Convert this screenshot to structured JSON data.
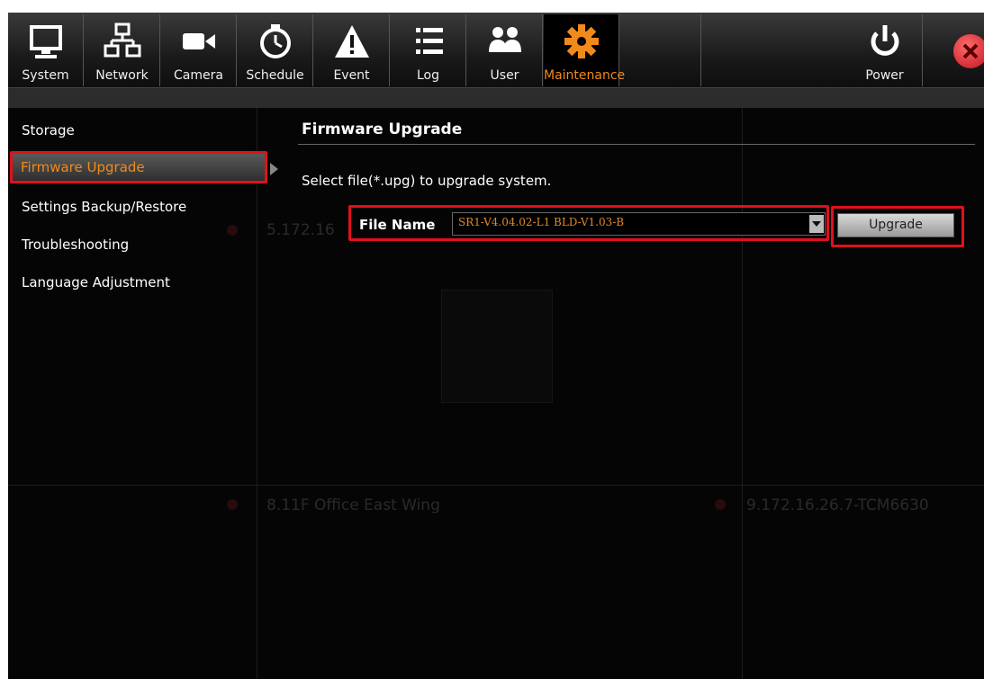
{
  "toolbar": {
    "items": [
      {
        "label": "System",
        "icon": "monitor-icon"
      },
      {
        "label": "Network",
        "icon": "network-icon"
      },
      {
        "label": "Camera",
        "icon": "camera-icon"
      },
      {
        "label": "Schedule",
        "icon": "clock-icon"
      },
      {
        "label": "Event",
        "icon": "warning-icon"
      },
      {
        "label": "Log",
        "icon": "list-icon"
      },
      {
        "label": "User",
        "icon": "users-icon"
      },
      {
        "label": "Maintenance",
        "icon": "gear-icon",
        "active": true
      },
      {
        "label": "Power",
        "icon": "power-icon"
      }
    ],
    "close_icon": "close-icon"
  },
  "sidebar": {
    "items": [
      {
        "label": "Storage"
      },
      {
        "label": "Firmware Upgrade",
        "selected": true
      },
      {
        "label": "Settings Backup/Restore"
      },
      {
        "label": "Troubleshooting"
      },
      {
        "label": "Language Adjustment"
      }
    ]
  },
  "main": {
    "title": "Firmware Upgrade",
    "instruction": "Select file(*.upg) to upgrade system.",
    "file_label": "File Name",
    "file_value": "SR1-V4.04.02-L1 BLD-V1.03-B",
    "upgrade_label": "Upgrade"
  },
  "background": {
    "ghost_1": "5.172.16",
    "ghost_2": "8.11F Office East Wing",
    "ghost_3": "9.172.16.26.7-TCM6630"
  },
  "colors": {
    "accent": "#f08a1c",
    "highlight": "#e0101d",
    "background": "#050505"
  }
}
